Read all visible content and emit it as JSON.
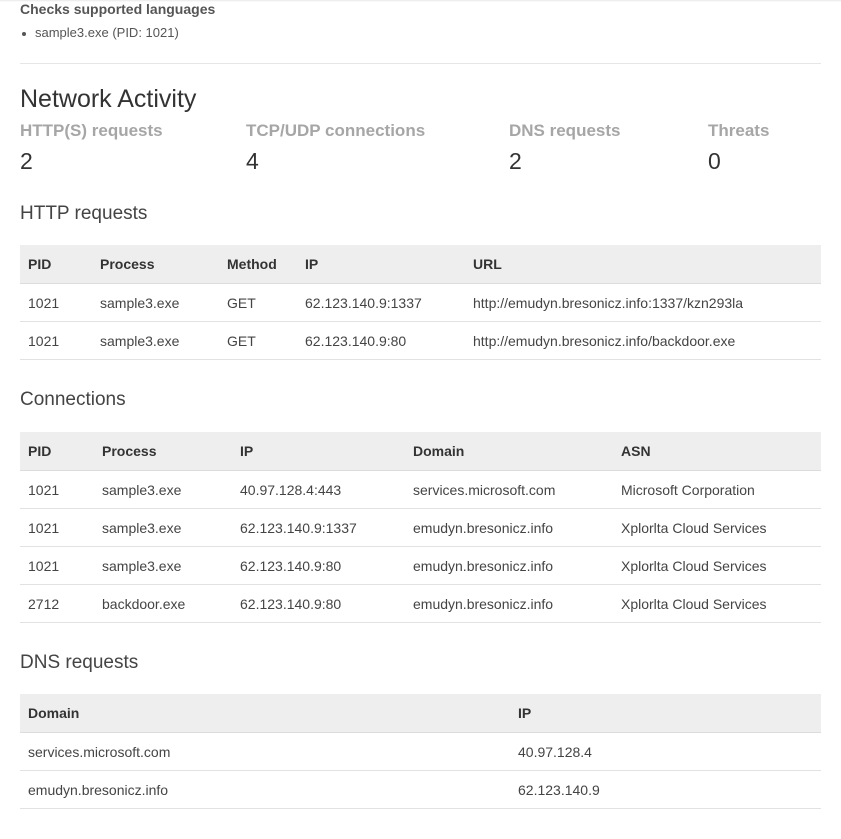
{
  "behavior": {
    "title": "Checks supported languages",
    "items": [
      "sample3.exe (PID: 1021)"
    ]
  },
  "network": {
    "title": "Network Activity",
    "stats": [
      {
        "label": "HTTP(S) requests",
        "value": "2"
      },
      {
        "label": "TCP/UDP connections",
        "value": "4"
      },
      {
        "label": "DNS requests",
        "value": "2"
      },
      {
        "label": "Threats",
        "value": "0"
      }
    ]
  },
  "http_requests": {
    "title": "HTTP requests",
    "headers": [
      "PID",
      "Process",
      "Method",
      "IP",
      "URL"
    ],
    "rows": [
      [
        "1021",
        "sample3.exe",
        "GET",
        "62.123.140.9:1337",
        "http://emudyn.bresonicz.info:1337/kzn293la"
      ],
      [
        "1021",
        "sample3.exe",
        "GET",
        "62.123.140.9:80",
        "http://emudyn.bresonicz.info/backdoor.exe"
      ]
    ]
  },
  "connections": {
    "title": "Connections",
    "headers": [
      "PID",
      "Process",
      "IP",
      "Domain",
      "ASN"
    ],
    "rows": [
      [
        "1021",
        "sample3.exe",
        "40.97.128.4:443",
        "services.microsoft.com",
        "Microsoft Corporation"
      ],
      [
        "1021",
        "sample3.exe",
        "62.123.140.9:1337",
        "emudyn.bresonicz.info",
        "Xplorlta Cloud Services"
      ],
      [
        "1021",
        "sample3.exe",
        "62.123.140.9:80",
        "emudyn.bresonicz.info",
        "Xplorlta Cloud Services"
      ],
      [
        "2712",
        "backdoor.exe",
        "62.123.140.9:80",
        "emudyn.bresonicz.info",
        "Xplorlta Cloud Services"
      ]
    ]
  },
  "dns_requests": {
    "title": "DNS requests",
    "headers": [
      "Domain",
      "IP"
    ],
    "rows": [
      [
        "services.microsoft.com",
        "40.97.128.4"
      ],
      [
        "emudyn.bresonicz.info",
        "62.123.140.9"
      ]
    ]
  }
}
